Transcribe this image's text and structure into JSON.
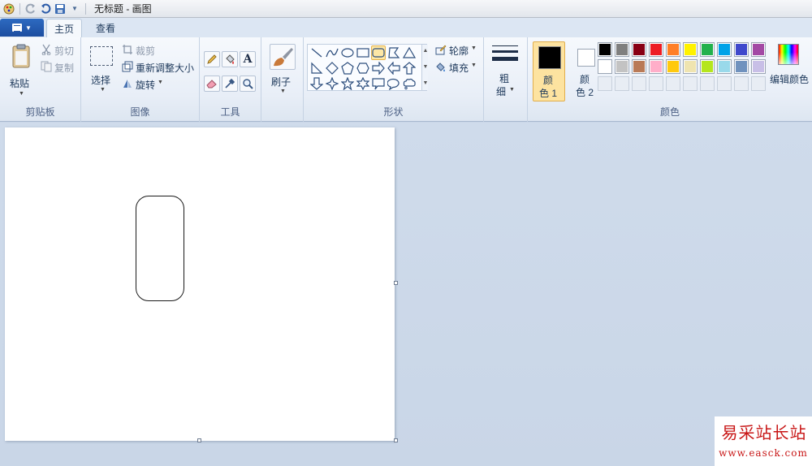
{
  "window": {
    "title": "无标题 - 画图"
  },
  "tabs": {
    "home": "主页",
    "view": "查看"
  },
  "clipboard": {
    "paste": "粘贴",
    "cut": "剪切",
    "copy": "复制",
    "group": "剪贴板"
  },
  "image": {
    "select": "选择",
    "crop": "裁剪",
    "resize": "重新调整大小",
    "rotate": "旋转",
    "group": "图像"
  },
  "tools": {
    "group": "工具"
  },
  "brushes": {
    "label": "刷子"
  },
  "shapes": {
    "outline": "轮廓",
    "fill": "填充",
    "group": "形状",
    "selected": "rounded-rectangle"
  },
  "size": {
    "label_1": "粗",
    "label_2": "细"
  },
  "colors": {
    "color1_label_1": "颜",
    "color1_label_2": "色 1",
    "color2_label_1": "颜",
    "color2_label_2": "色 2",
    "edit": "编辑颜色",
    "group": "颜色",
    "color1": "#000000",
    "color2": "#ffffff",
    "row1": [
      "#000000",
      "#7f7f7f",
      "#880015",
      "#ed1c24",
      "#ff7f27",
      "#fff200",
      "#22b14c",
      "#00a2e8",
      "#3f48cc",
      "#a349a4"
    ],
    "row2": [
      "#ffffff",
      "#c3c3c3",
      "#b97a57",
      "#ffaec9",
      "#ffc90e",
      "#efe4b0",
      "#b5e61d",
      "#99d9ea",
      "#7092be",
      "#c8bfe7"
    ]
  },
  "watermark": {
    "main": "易采站长站",
    "url": "www.easck.com"
  }
}
